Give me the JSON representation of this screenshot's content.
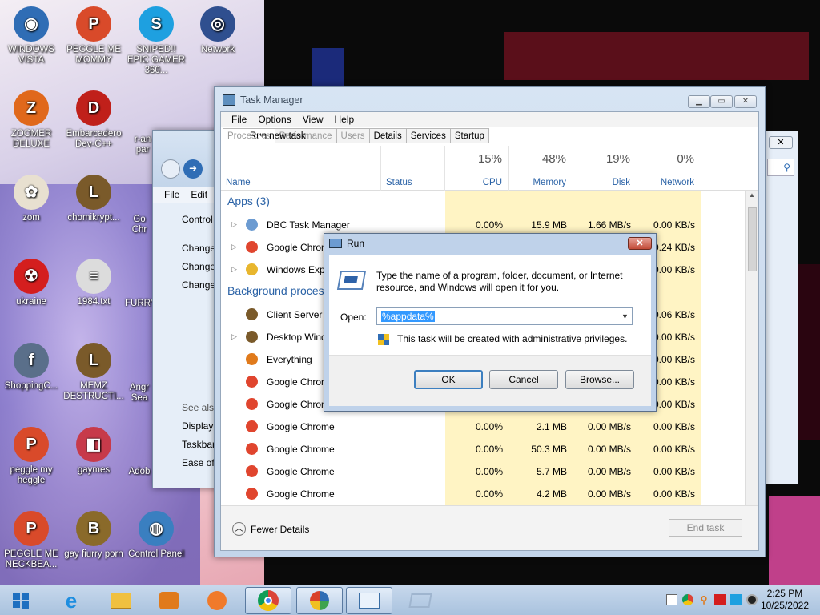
{
  "desktop": {
    "icons": [
      {
        "label": "WINDOWS VISTA",
        "color": "#2f6db5",
        "glyph": "◉"
      },
      {
        "label": "PEGGLE ME MOMMY",
        "color": "#d94a2a",
        "glyph": "P"
      },
      {
        "label": "SNIPED!! EPIC GAMER 360...",
        "color": "#1ea0e0",
        "glyph": "S"
      },
      {
        "label": "Network",
        "color": "#2f4f8f",
        "glyph": "◎"
      },
      {
        "label": "ZOOMER DELUXE",
        "color": "#e0681b",
        "glyph": "Z"
      },
      {
        "label": "Embarcadero Dev-C++",
        "color": "#c0201a",
        "glyph": "D"
      },
      {
        "label": "zom",
        "color": "#e8e0d0",
        "glyph": "✿"
      },
      {
        "label": "chomikrypt...",
        "color": "#7a5a2a",
        "glyph": "L"
      },
      {
        "label": "ukraine",
        "color": "#d41e1e",
        "glyph": "☢"
      },
      {
        "label": "1984.txt",
        "color": "#dcdcdc",
        "glyph": "≡"
      },
      {
        "label": "ShoppingC...",
        "color": "#5a6f8a",
        "glyph": "f"
      },
      {
        "label": "MEMZ DESTRUCTI...",
        "color": "#7a5a2a",
        "glyph": "L"
      },
      {
        "label": "peggle my heggle",
        "color": "#d94a2a",
        "glyph": "P"
      },
      {
        "label": "gaymes",
        "color": "#c73a4a",
        "glyph": "◧"
      },
      {
        "label": "PEGGLE ME NECKBEA...",
        "color": "#d94a2a",
        "glyph": "P"
      },
      {
        "label": "gay fiurry porn",
        "color": "#8a6a2a",
        "glyph": "B"
      },
      {
        "label": "Control Panel",
        "color": "#3a7fc0",
        "glyph": "◍"
      }
    ],
    "partial_labels": [
      "r-an par",
      "Go Chr",
      "FURRY",
      "Angr Sea",
      "Adob"
    ]
  },
  "control_panel": {
    "menu": [
      "File",
      "Edit"
    ],
    "links": [
      "Control",
      "Change",
      "Change",
      "Change"
    ],
    "see_also_title": "See also",
    "see_also": [
      "Display",
      "Taskbar",
      "Ease of"
    ]
  },
  "task_manager": {
    "title": "Task Manager",
    "menu": [
      "File",
      "Options",
      "View",
      "Help"
    ],
    "tabs": [
      "Processes",
      "Performance",
      "Users",
      "Details",
      "Services",
      "Startup"
    ],
    "hover_text": "Run new task",
    "columns": {
      "name": "Name",
      "status": "Status",
      "cpu": {
        "pct": "15%",
        "label": "CPU"
      },
      "memory": {
        "pct": "48%",
        "label": "Memory"
      },
      "disk": {
        "pct": "19%",
        "label": "Disk"
      },
      "network": {
        "pct": "0%",
        "label": "Network"
      }
    },
    "apps_header": "Apps (3)",
    "bg_header": "Background process",
    "rows": [
      {
        "name": "DBC Task Manager",
        "cpu": "0.00%",
        "mem": "15.9 MB",
        "disk": "1.66 MB/s",
        "net": "0.00 KB/s",
        "icon_color": "#6c9bd1",
        "exp": "▷"
      },
      {
        "name": "Google Chrome",
        "cpu": "",
        "mem": "",
        "disk": "",
        "net": "0.24 KB/s",
        "icon_color": "#e0452e",
        "exp": "▷"
      },
      {
        "name": "Windows Explo",
        "cpu": "",
        "mem": "",
        "disk": "",
        "net": "0.00 KB/s",
        "icon_color": "#e8b62e",
        "exp": "▷"
      },
      {
        "name": "Client Server R",
        "cpu": "",
        "mem": "",
        "disk": "",
        "net": "0.06 KB/s",
        "icon_color": "#7a5a2a",
        "exp": ""
      },
      {
        "name": "Desktop Windo",
        "cpu": "",
        "mem": "",
        "disk": "",
        "net": "0.00 KB/s",
        "icon_color": "#7a5a2a",
        "exp": "▷"
      },
      {
        "name": "Everything",
        "cpu": "",
        "mem": "",
        "disk": "",
        "net": "0.00 KB/s",
        "icon_color": "#e07a1b",
        "exp": ""
      },
      {
        "name": "Google Chrome",
        "cpu": "",
        "mem": "",
        "disk": "",
        "net": "0.00 KB/s",
        "icon_color": "#e0452e",
        "exp": ""
      },
      {
        "name": "Google Chrome",
        "cpu": "",
        "mem": "",
        "disk": "",
        "net": "0.00 KB/s",
        "icon_color": "#e0452e",
        "exp": ""
      },
      {
        "name": "Google Chrome",
        "cpu": "0.00%",
        "mem": "2.1 MB",
        "disk": "0.00 MB/s",
        "net": "0.00 KB/s",
        "icon_color": "#e0452e",
        "exp": ""
      },
      {
        "name": "Google Chrome",
        "cpu": "0.00%",
        "mem": "50.3 MB",
        "disk": "0.00 MB/s",
        "net": "0.00 KB/s",
        "icon_color": "#e0452e",
        "exp": ""
      },
      {
        "name": "Google Chrome",
        "cpu": "0.00%",
        "mem": "5.7 MB",
        "disk": "0.00 MB/s",
        "net": "0.00 KB/s",
        "icon_color": "#e0452e",
        "exp": ""
      },
      {
        "name": "Google Chrome",
        "cpu": "0.00%",
        "mem": "4.2 MB",
        "disk": "0.00 MB/s",
        "net": "0.00 KB/s",
        "icon_color": "#e0452e",
        "exp": ""
      }
    ],
    "fewer_details": "Fewer Details",
    "end_task": "End task"
  },
  "run_dialog": {
    "title": "Run",
    "description": "Type the name of a program, folder, document, or Internet resource, and Windows will open it for you.",
    "open_label": "Open:",
    "open_value": "%appdata%",
    "admin_note": "This task will be created with administrative privileges.",
    "ok": "OK",
    "cancel": "Cancel",
    "browse": "Browse..."
  },
  "taskbar": {
    "time": "2:25 PM",
    "date": "10/25/2022"
  }
}
